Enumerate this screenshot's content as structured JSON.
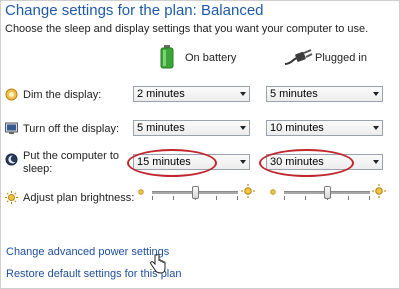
{
  "header": {
    "title": "Change settings for the plan: Balanced",
    "subtitle": "Choose the sleep and display settings that you want your computer to use."
  },
  "columns": {
    "battery": "On battery",
    "plugged": "Plugged in"
  },
  "rows": {
    "dim": {
      "label": "Dim the display:",
      "battery": "2 minutes",
      "plugged": "5 minutes"
    },
    "off": {
      "label": "Turn off the display:",
      "battery": "5 minutes",
      "plugged": "10 minutes"
    },
    "sleep": {
      "label_line1": "Put the computer to",
      "label_line2": "sleep:",
      "battery": "15 minutes",
      "plugged": "30 minutes"
    },
    "brightness": {
      "label": "Adjust plan brightness:",
      "battery_level": 0.5,
      "plugged_level": 0.5
    }
  },
  "links": {
    "advanced": "Change advanced power settings",
    "restore": "Restore default settings for this plan"
  },
  "colors": {
    "title": "#1e5aa8",
    "link": "#1f4e9c",
    "highlight_oval": "#c0272d",
    "battery_green": "#3aa635"
  }
}
